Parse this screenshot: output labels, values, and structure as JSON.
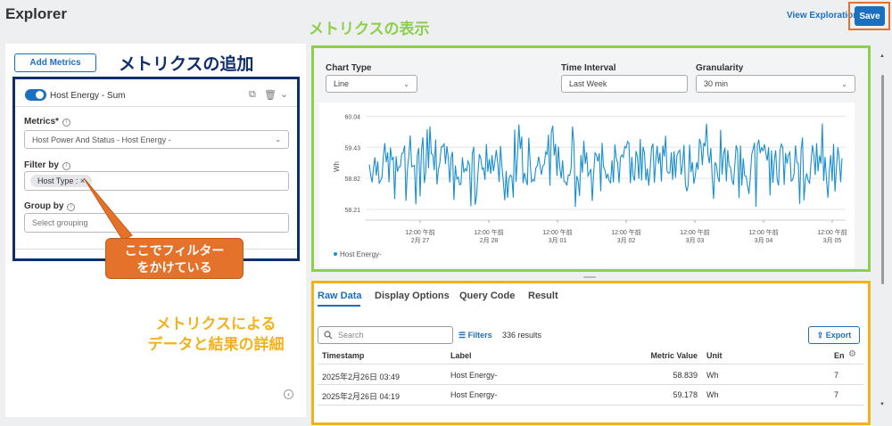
{
  "header": {
    "app_title": "Explorer",
    "view_explorations": "View Explorations",
    "save_label": "Save"
  },
  "left_panel": {
    "add_metrics_label": "Add Metrics",
    "metric_card": {
      "name": "Host Energy - Sum",
      "metrics_label": "Metrics*",
      "metrics_value": "Host Power And Status - Host Energy -",
      "filter_label": "Filter by",
      "filter_chip": "Host Type  :",
      "filter_chip_remove": "×",
      "group_label": "Group by",
      "group_placeholder": "Select grouping"
    }
  },
  "annotations": {
    "add_metrics": "メトリクスの追加",
    "show_metrics": "メトリクスの表示",
    "filter_callout_1": "ここでフィルター",
    "filter_callout_2": "をかけている",
    "data_detail_1": "メトリクスによる",
    "data_detail_2": "データと結果の詳細"
  },
  "chart_controls": {
    "chart_type_label": "Chart Type",
    "chart_type_value": "Line",
    "time_interval_label": "Time Interval",
    "time_interval_value": "Last Week",
    "granularity_label": "Granularity",
    "granularity_value": "30 min"
  },
  "chart_data": {
    "type": "line",
    "ylabel": "Wh",
    "ylim": [
      58.0,
      60.1
    ],
    "yticks": [
      60.04,
      59.43,
      58.82,
      58.21
    ],
    "xticks": [
      {
        "time": "12:00 午前",
        "date": "2月 27"
      },
      {
        "time": "12:00 午前",
        "date": "2月 28"
      },
      {
        "time": "12:00 午前",
        "date": "3月 01"
      },
      {
        "time": "12:00 午前",
        "date": "3月 02"
      },
      {
        "time": "12:00 午前",
        "date": "3月 03"
      },
      {
        "time": "12:00 午前",
        "date": "3月 04"
      },
      {
        "time": "12:00 午前",
        "date": "3月 05"
      }
    ],
    "series": [
      {
        "name": "Host Energy-",
        "color": "#1a8fd0"
      }
    ],
    "legend": "bottom-left"
  },
  "data_panel": {
    "tabs": [
      "Raw Data",
      "Display Options",
      "Query Code",
      "Result"
    ],
    "search_placeholder": "Search",
    "filters_label": "Filters",
    "results_count": "336 results",
    "export_label": "Export",
    "columns": [
      "Timestamp",
      "Label",
      "Metric Value",
      "Unit",
      "En"
    ],
    "rows": [
      [
        "2025年2月26日 03:49",
        "Host Energy-",
        "58.839",
        "Wh",
        "7"
      ],
      [
        "2025年2月26日 04:19",
        "Host Energy-",
        "59.178",
        "Wh",
        "7"
      ]
    ]
  }
}
